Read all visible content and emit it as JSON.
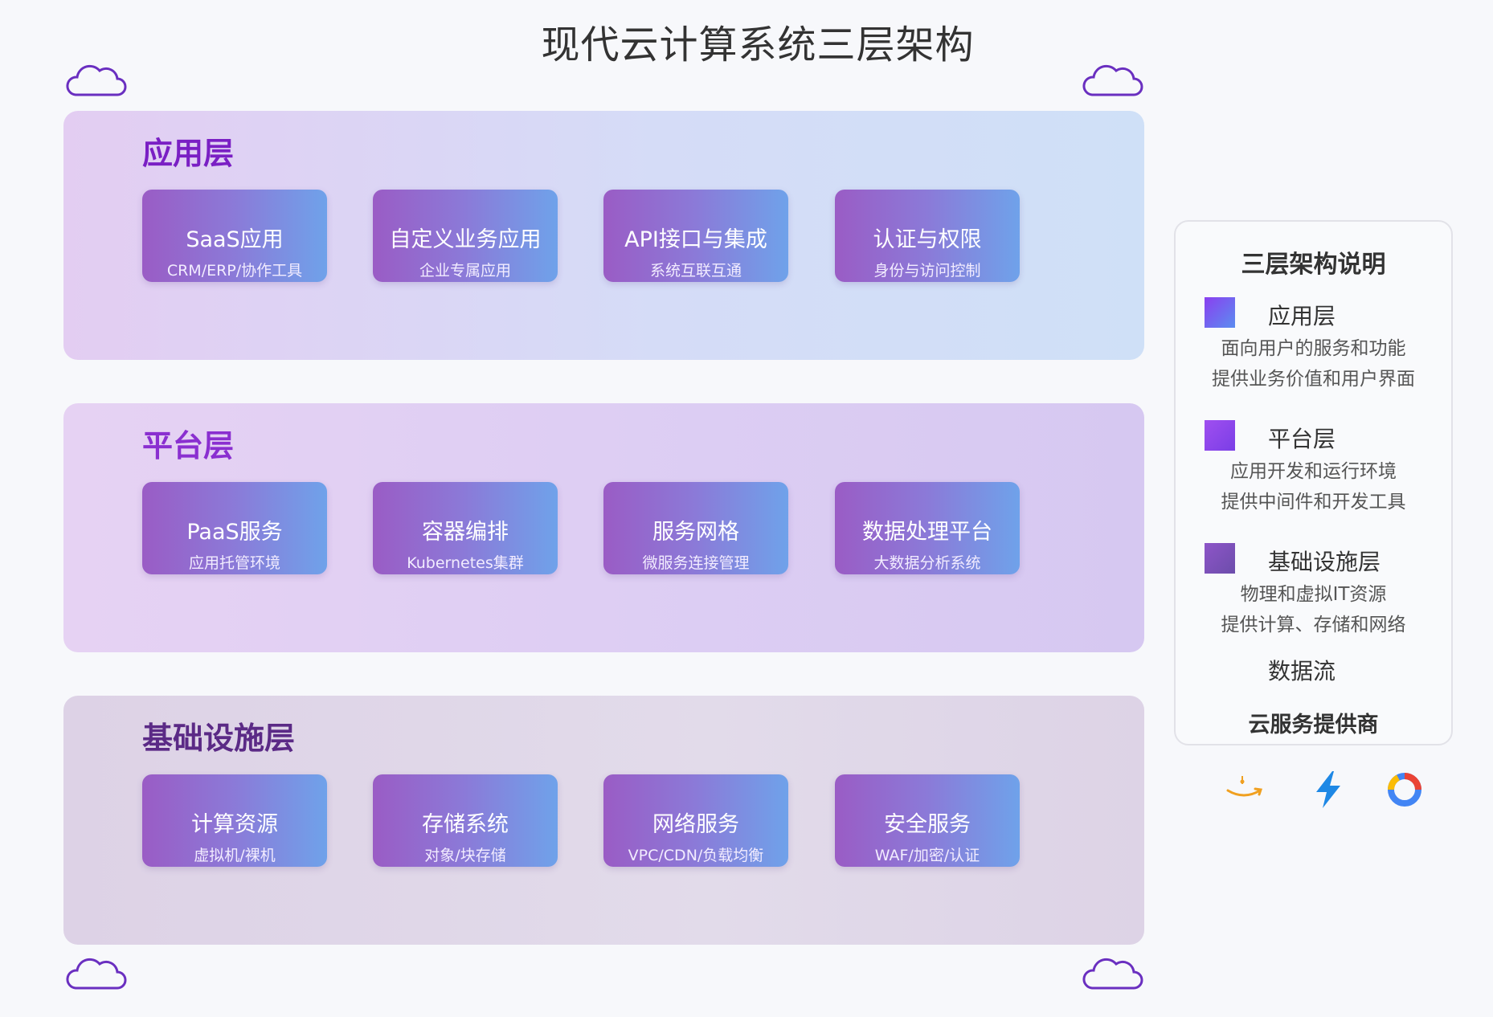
{
  "title": "现代云计算系统三层架构",
  "layers": [
    {
      "name": "应用层",
      "cards": [
        {
          "title": "SaaS应用",
          "sub": "CRM/ERP/协作工具"
        },
        {
          "title": "自定义业务应用",
          "sub": "企业专属应用"
        },
        {
          "title": "API接口与集成",
          "sub": "系统互联互通"
        },
        {
          "title": "认证与权限",
          "sub": "身份与访问控制"
        }
      ]
    },
    {
      "name": "平台层",
      "cards": [
        {
          "title": "PaaS服务",
          "sub": "应用托管环境"
        },
        {
          "title": "容器编排",
          "sub": "Kubernetes集群"
        },
        {
          "title": "服务网格",
          "sub": "微服务连接管理"
        },
        {
          "title": "数据处理平台",
          "sub": "大数据分析系统"
        }
      ]
    },
    {
      "name": "基础设施层",
      "cards": [
        {
          "title": "计算资源",
          "sub": "虚拟机/裸机"
        },
        {
          "title": "存储系统",
          "sub": "对象/块存储"
        },
        {
          "title": "网络服务",
          "sub": "VPC/CDN/负载均衡"
        },
        {
          "title": "安全服务",
          "sub": "WAF/加密/认证"
        }
      ]
    }
  ],
  "legend": {
    "title": "三层架构说明",
    "items": [
      {
        "name": "应用层",
        "line1": "面向用户的服务和功能",
        "line2": "提供业务价值和用户界面"
      },
      {
        "name": "平台层",
        "line1": "应用开发和运行环境",
        "line2": "提供中间件和开发工具"
      },
      {
        "name": "基础设施层",
        "line1": "物理和虚拟IT资源",
        "line2": "提供计算、存储和网络"
      }
    ],
    "data_flow": "数据流",
    "providers": "云服务提供商"
  },
  "icons": {
    "cloud": "cloud-icon",
    "providers": [
      "amazon-smile-icon",
      "lightning-icon",
      "google-cloud-icon"
    ]
  },
  "colors": {
    "app_title": "#7a1fc4",
    "platform_title": "#8a2fd0",
    "infra_title": "#5b2a86",
    "cloud_stroke": "#6a2fc0"
  }
}
